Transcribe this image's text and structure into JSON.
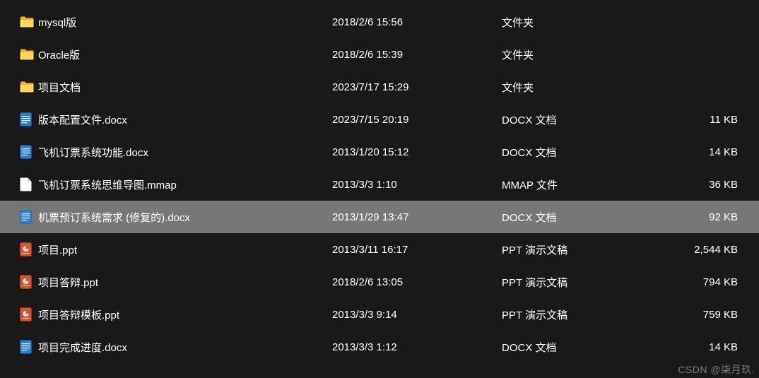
{
  "files": [
    {
      "icon": "folder",
      "name": "mysql版",
      "date": "2018/2/6 15:56",
      "type": "文件夹",
      "size": "",
      "selected": false
    },
    {
      "icon": "folder",
      "name": "Oracle版",
      "date": "2018/2/6 15:39",
      "type": "文件夹",
      "size": "",
      "selected": false
    },
    {
      "icon": "folder",
      "name": "项目文档",
      "date": "2023/7/17 15:29",
      "type": "文件夹",
      "size": "",
      "selected": false
    },
    {
      "icon": "docx",
      "name": "版本配置文件.docx",
      "date": "2023/7/15 20:19",
      "type": "DOCX 文档",
      "size": "11 KB",
      "selected": false
    },
    {
      "icon": "docx",
      "name": "飞机订票系统功能.docx",
      "date": "2013/1/20 15:12",
      "type": "DOCX 文档",
      "size": "14 KB",
      "selected": false
    },
    {
      "icon": "file",
      "name": "飞机订票系统思维导图.mmap",
      "date": "2013/3/3 1:10",
      "type": "MMAP 文件",
      "size": "36 KB",
      "selected": false
    },
    {
      "icon": "docx",
      "name": "机票预订系统需求 (修复的).docx",
      "date": "2013/1/29 13:47",
      "type": "DOCX 文档",
      "size": "92 KB",
      "selected": true
    },
    {
      "icon": "ppt",
      "name": "项目.ppt",
      "date": "2013/3/11 16:17",
      "type": "PPT 演示文稿",
      "size": "2,544 KB",
      "selected": false
    },
    {
      "icon": "ppt",
      "name": "项目答辩.ppt",
      "date": "2018/2/6 13:05",
      "type": "PPT 演示文稿",
      "size": "794 KB",
      "selected": false
    },
    {
      "icon": "ppt",
      "name": "项目答辩模板.ppt",
      "date": "2013/3/3 9:14",
      "type": "PPT 演示文稿",
      "size": "759 KB",
      "selected": false
    },
    {
      "icon": "docx",
      "name": "项目完成进度.docx",
      "date": "2013/3/3 1:12",
      "type": "DOCX 文档",
      "size": "14 KB",
      "selected": false
    }
  ],
  "watermark": "CSDN @柒月玖."
}
